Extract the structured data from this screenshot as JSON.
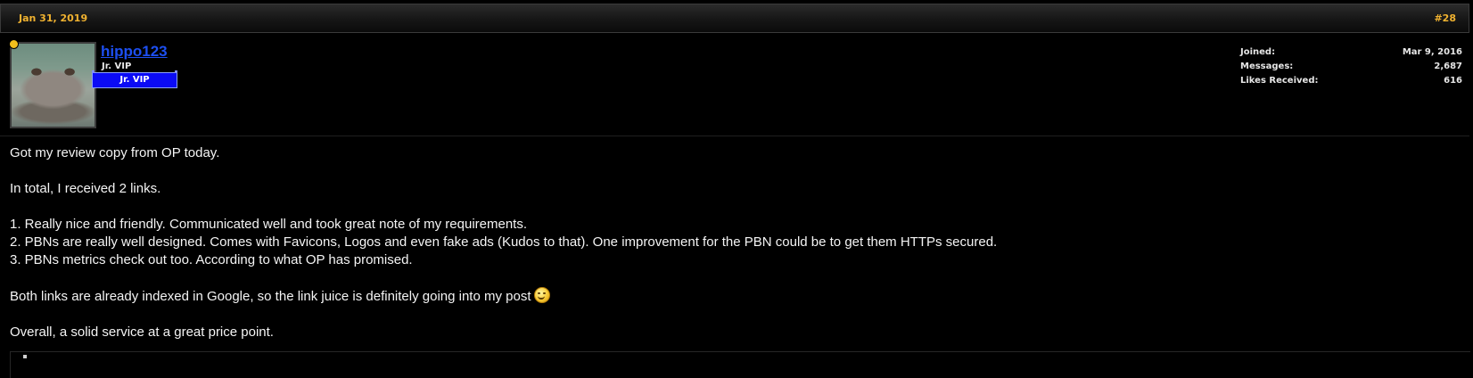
{
  "post": {
    "date": "Jan 31, 2019",
    "number": "#28",
    "user": {
      "username": "hippo123",
      "title": "Jr. VIP",
      "banner": "Jr. VIP",
      "online": true,
      "avatar_icon": "hippo-avatar",
      "stats": [
        {
          "label": "Joined:",
          "value": "Mar 9, 2016"
        },
        {
          "label": "Messages:",
          "value": "2,687"
        },
        {
          "label": "Likes Received:",
          "value": "616"
        }
      ]
    },
    "body": {
      "line1": "Got my review copy from OP today.",
      "line2": "In total, I received 2 links.",
      "line3": "1. Really nice and friendly. Communicated well and took great note of my requirements.",
      "line4": "2. PBNs are really well designed. Comes with Favicons, Logos and even fake ads (Kudos to that). One improvement for the PBN could be to get them HTTPs secured.",
      "line5": "3. PBNs metrics check out too. According to what OP has promised.",
      "line6": "Both links are already indexed in Google, so the link juice is definitely going into my post",
      "line6_icon": "grin-smiley-icon",
      "line7": "Overall, a solid service at a great price point."
    },
    "colors": {
      "accent": "#f0b230",
      "username": "#1d4ff0",
      "banner": "#0b0bf5",
      "online_dot": "#f2c01c",
      "background": "#000000",
      "text": "#f4f4f4"
    }
  }
}
